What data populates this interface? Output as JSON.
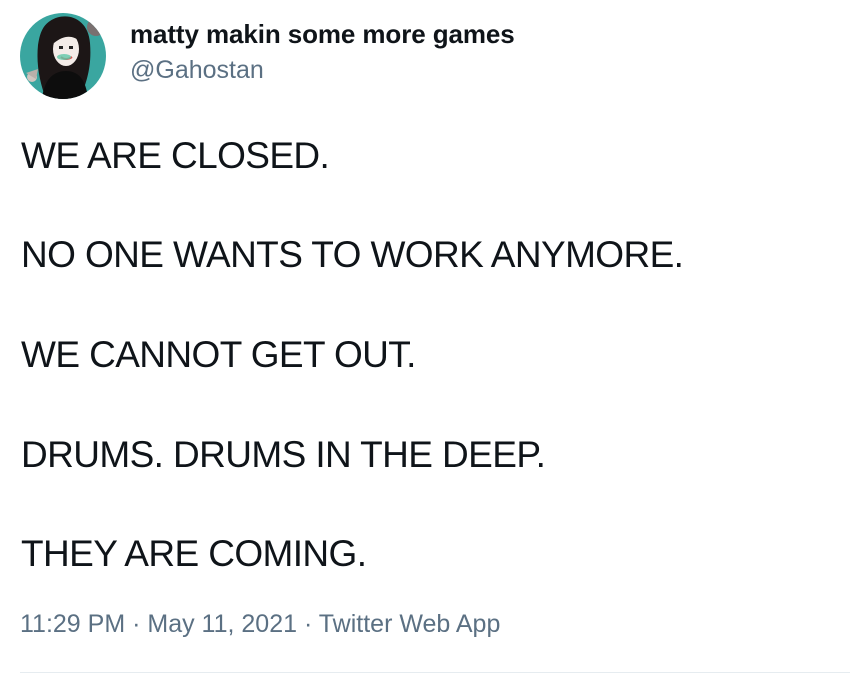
{
  "author": {
    "display_name": "matty makin some more games",
    "handle": "@Gahostan"
  },
  "tweet": {
    "lines": [
      "WE ARE CLOSED.",
      "NO ONE WANTS TO WORK ANYMORE.",
      "WE CANNOT GET OUT.",
      "DRUMS. DRUMS IN THE DEEP.",
      "THEY ARE COMING."
    ]
  },
  "meta": {
    "time": "11:29 PM",
    "separator": " · ",
    "date": "May 11, 2021",
    "source": "Twitter Web App"
  },
  "colors": {
    "text": "#0f1419",
    "secondary": "#5b7083",
    "avatar_bg": "#3aa6a0"
  },
  "icons": {
    "avatar": "profile-avatar-illustration"
  }
}
